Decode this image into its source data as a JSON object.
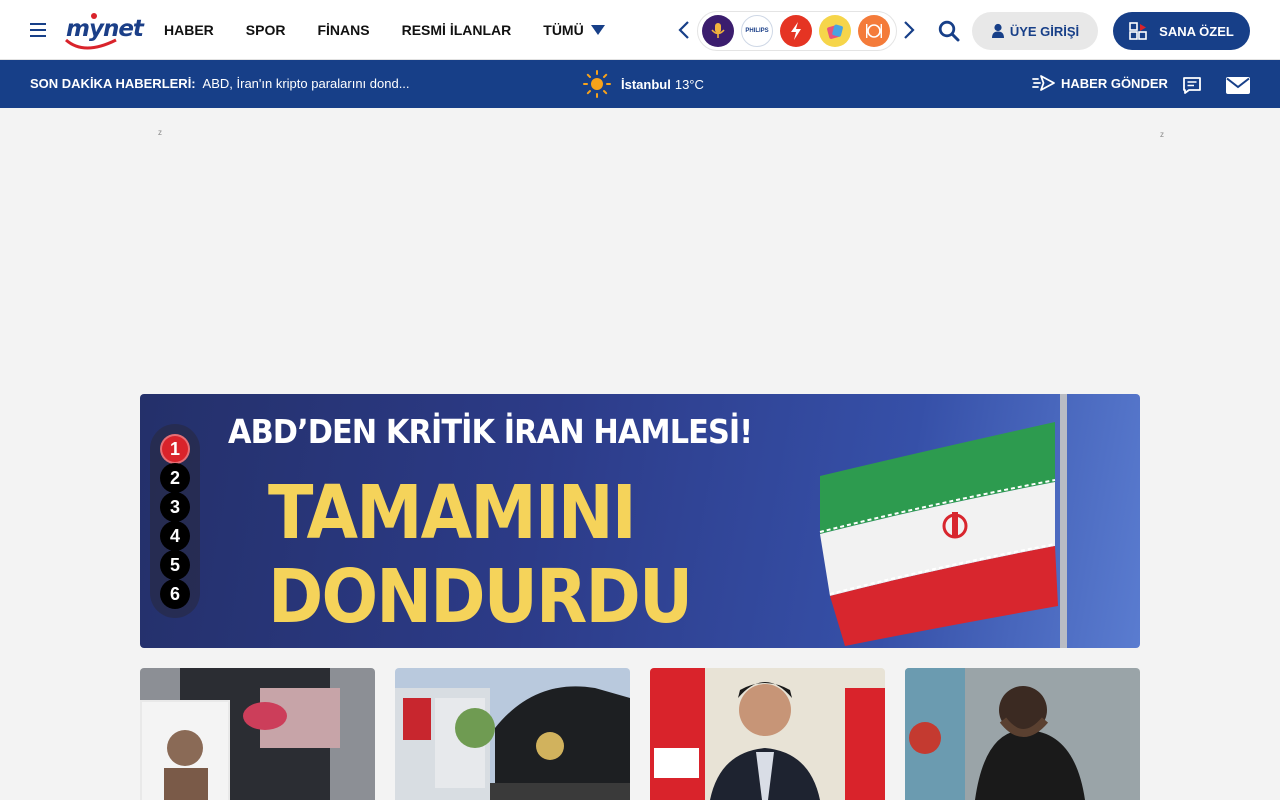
{
  "header": {
    "logo_text": "mynet",
    "nav": [
      {
        "label": "HABER"
      },
      {
        "label": "SPOR"
      },
      {
        "label": "FİNANS"
      },
      {
        "label": "RESMİ İLANLAR"
      }
    ],
    "more_label": "TÜMÜ",
    "shortcuts": [
      {
        "icon": "podcast-mic-icon"
      },
      {
        "icon": "philips-logo-icon",
        "text": "PHILIPS"
      },
      {
        "icon": "flash-icon"
      },
      {
        "icon": "shopping-tag-icon"
      },
      {
        "icon": "food-plate-icon"
      }
    ],
    "login_label": "ÜYE GİRİŞİ",
    "special_label": "SANA ÖZEL"
  },
  "ticker": {
    "label": "SON DAKİKA HABERLERİ:",
    "headline": "ABD, İran'ın kripto paralarını dond..."
  },
  "weather": {
    "city": "İstanbul",
    "temp": "13°C"
  },
  "actions": {
    "send_news_label": "HABER GÖNDER"
  },
  "ad": {
    "left_mark": "z",
    "right_mark": "z"
  },
  "hero": {
    "kicker": "ABD’DEN KRİTİK İRAN HAMLESİ!",
    "line1": "TAMAMINI",
    "line2": "DONDURDU"
  },
  "slider": {
    "pages": [
      "1",
      "2",
      "3",
      "4",
      "5",
      "6"
    ],
    "active": "1"
  },
  "colors": {
    "brand_blue": "#173f88",
    "accent_red": "#d9232b",
    "hero_yellow": "#f5d35a"
  }
}
